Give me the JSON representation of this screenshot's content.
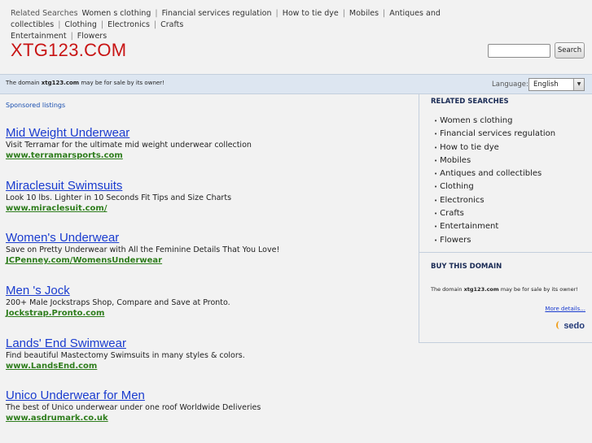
{
  "topbar": {
    "label": "Related Searches",
    "links": [
      "Women s clothing",
      "Financial services regulation",
      "How to tie dye",
      "Mobiles",
      "Antiques and collectibles",
      "Clothing",
      "Electronics",
      "Crafts",
      "Entertainment",
      "Flowers"
    ]
  },
  "header": {
    "logo": "XTG123.COM",
    "search_button": "Search",
    "search_value": ""
  },
  "domain_bar": {
    "msg_pre": "The domain",
    "domain": "xtg123.com",
    "msg_post": "may be for sale by its owner!",
    "language_label": "Language:",
    "language_value": "English"
  },
  "sponsored_label": "Sponsored listings",
  "listings": [
    {
      "title": "Mid Weight Underwear",
      "desc": "Visit Terramar for the ultimate mid weight underwear collection",
      "url": "www.terramarsports.com"
    },
    {
      "title": "Miraclesuit Swimsuits",
      "desc": "Look 10 lbs. Lighter in 10 Seconds Fit Tips and Size Charts",
      "url": "www.miraclesuit.com/"
    },
    {
      "title": "Women's Underwear",
      "desc": "Save on Pretty Underwear with All the Feminine Details That You Love!",
      "url": "JCPenney.com/WomensUnderwear"
    },
    {
      "title": "Men 's Jock",
      "desc": "200+ Male Jockstraps Shop, Compare and Save at Pronto.",
      "url": "Jockstrap.Pronto.com"
    },
    {
      "title": "Lands' End Swimwear",
      "desc": "Find beautiful Mastectomy Swimsuits in many styles & colors.",
      "url": "www.LandsEnd.com"
    },
    {
      "title": "Unico Underwear for Men",
      "desc": "The best of Unico underwear under one roof Worldwide Deliveries",
      "url": "www.asdrumark.co.uk"
    }
  ],
  "sidebar": {
    "related_heading": "RELATED SEARCHES",
    "related": [
      "Women s clothing",
      "Financial services regulation",
      "How to tie dye",
      "Mobiles",
      "Antiques and collectibles",
      "Clothing",
      "Electronics",
      "Crafts",
      "Entertainment",
      "Flowers"
    ],
    "buy_heading": "BUY THIS DOMAIN",
    "buy_pre": "The domain",
    "buy_domain": "xtg123.com",
    "buy_post": "may be for sale by its owner!",
    "more_details": "More details...",
    "sedo_logo": "sedo"
  },
  "colors": {
    "logo": "#c81414",
    "link": "#1a3ccf",
    "url": "#2e7d1c",
    "domain_bar": "#dde6f1"
  }
}
